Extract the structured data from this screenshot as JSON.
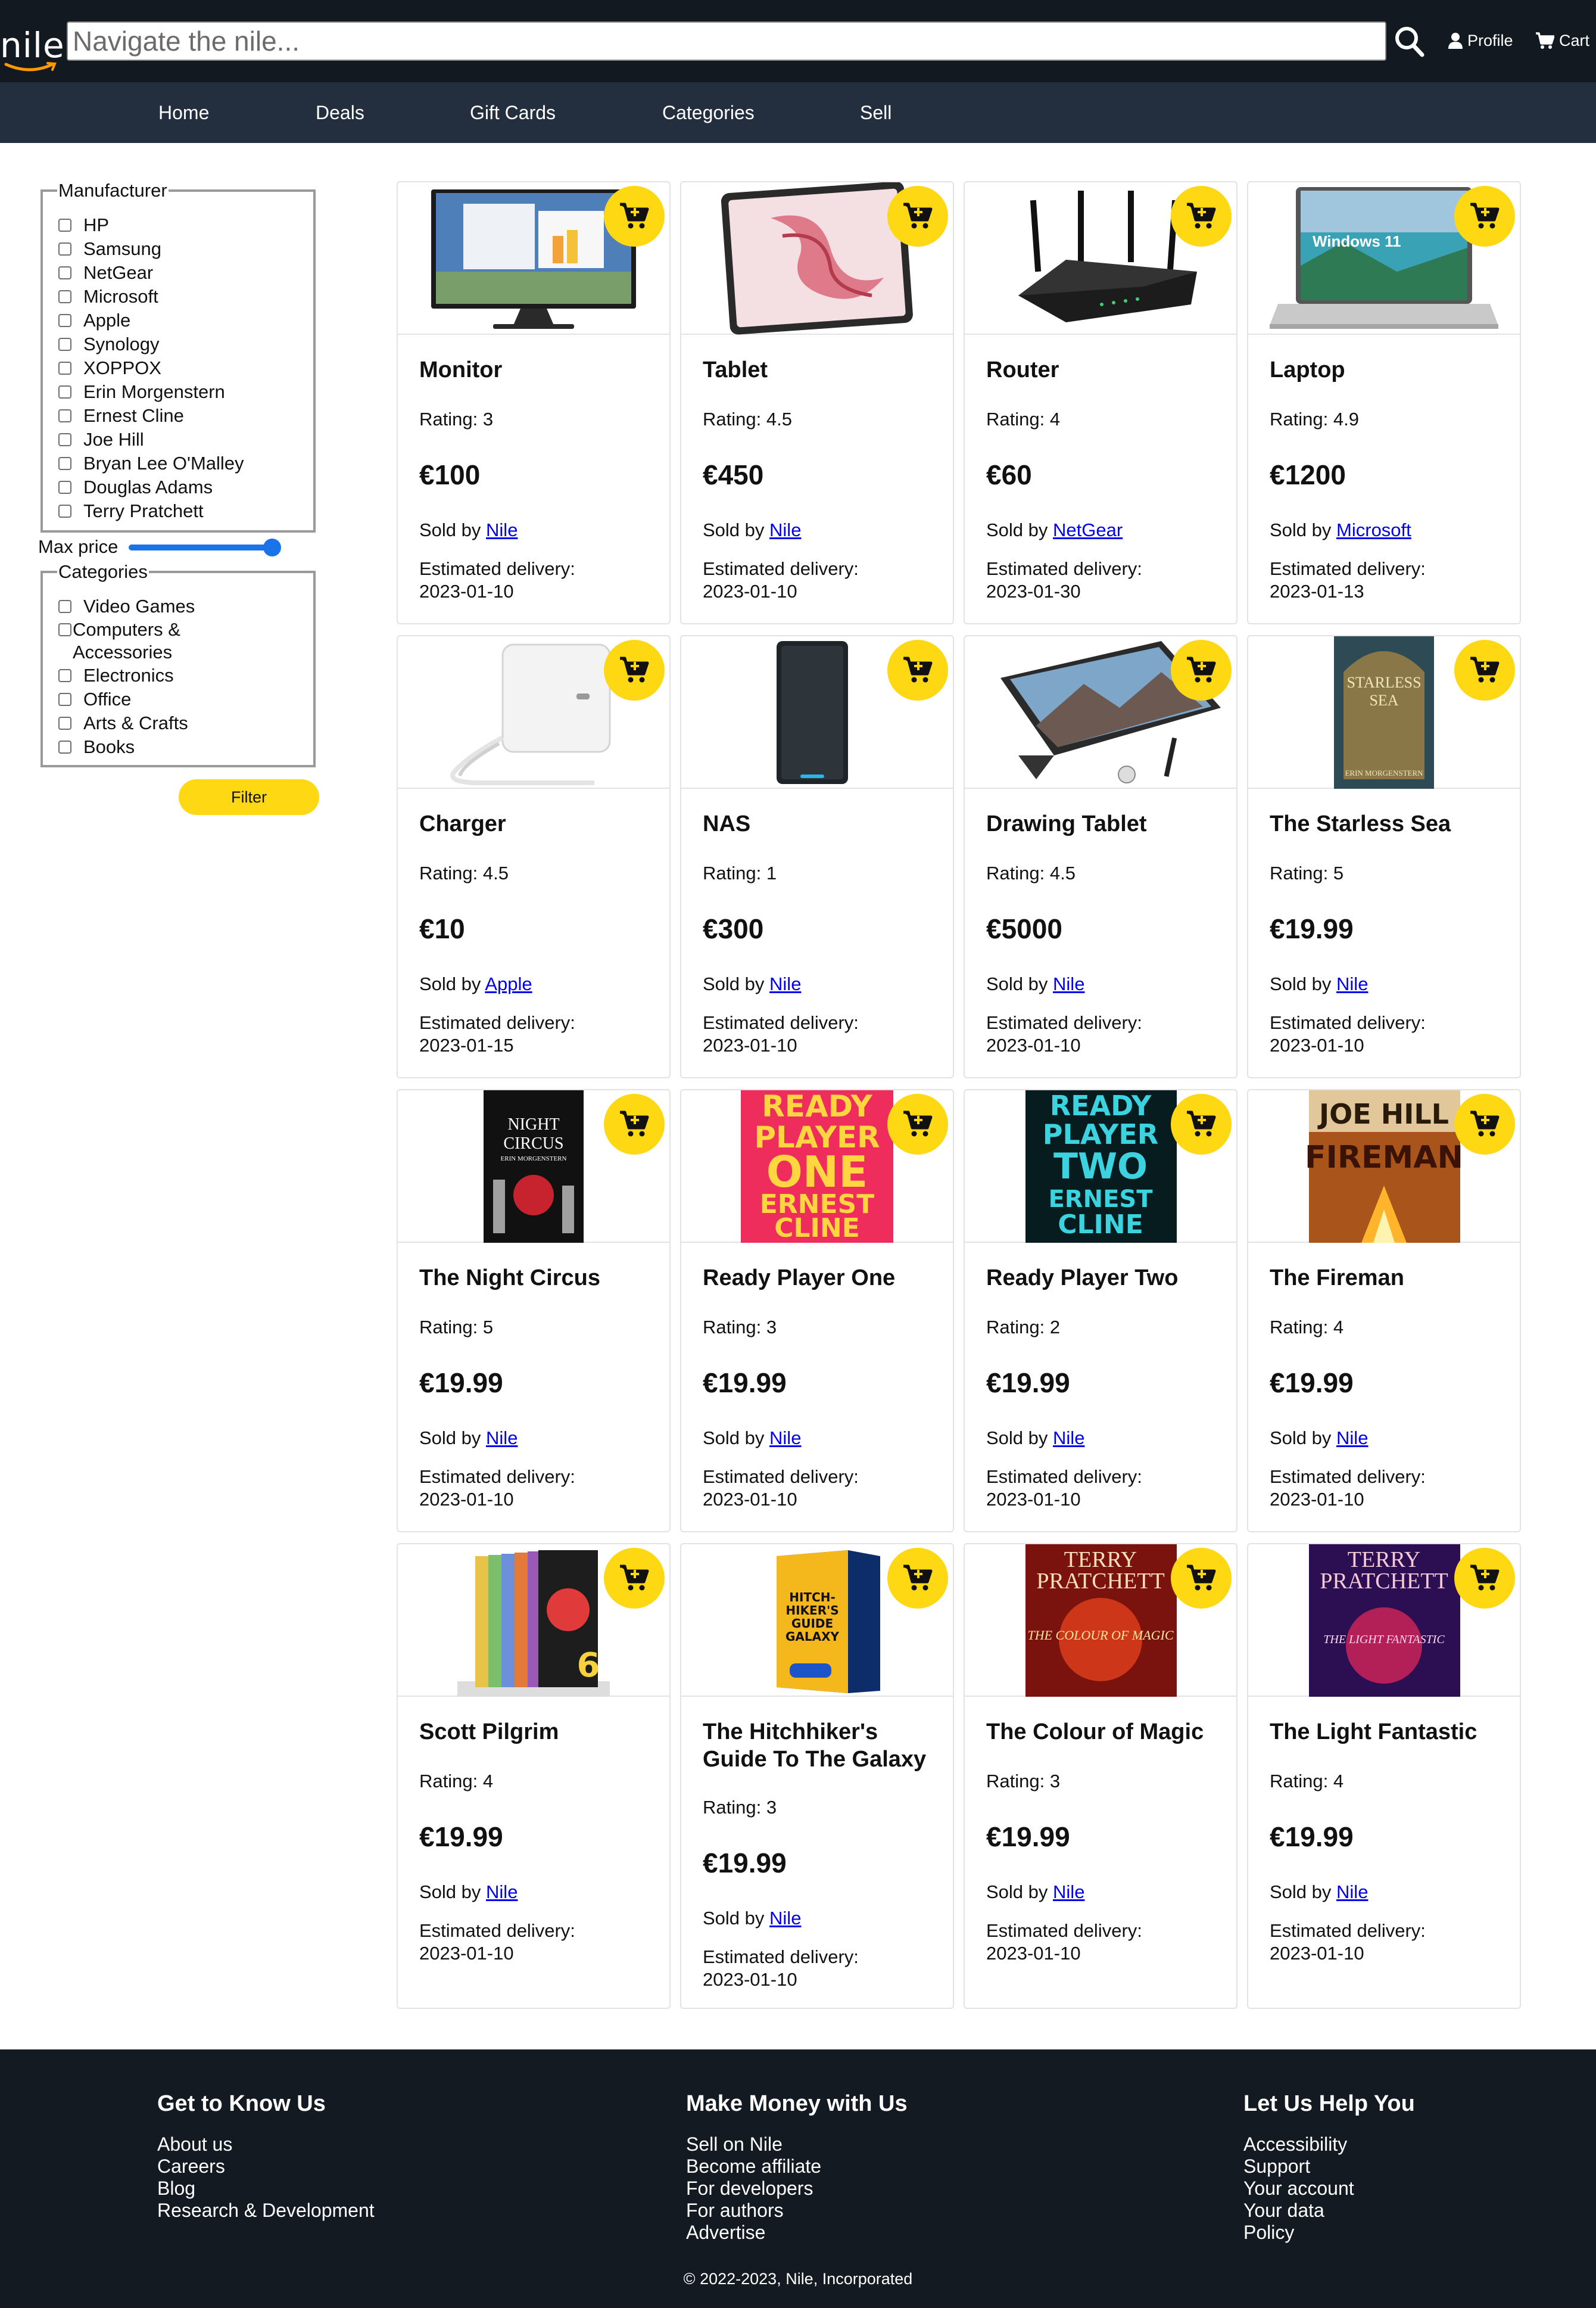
{
  "header": {
    "logo_text": "nile",
    "search_placeholder": "Navigate the nile...",
    "profile_label": "Profile",
    "cart_label": "Cart"
  },
  "nav": {
    "items": [
      "Home",
      "Deals",
      "Gift Cards",
      "Categories",
      "Sell"
    ]
  },
  "filters": {
    "manufacturer_legend": "Manufacturer",
    "manufacturers": [
      "HP",
      "Samsung",
      "NetGear",
      "Microsoft",
      "Apple",
      "Synology",
      "XOPPOX",
      "Erin Morgenstern",
      "Ernest Cline",
      "Joe Hill",
      "Bryan Lee O'Malley",
      "Douglas Adams",
      "Terry Pratchett"
    ],
    "max_price_label": "Max price",
    "max_price_level": 1.0,
    "categories_legend": "Categories",
    "categories": [
      "Video Games",
      "Computers & Accessories",
      "Electronics",
      "Office",
      "Arts & Crafts",
      "Books"
    ],
    "filter_button": "Filter"
  },
  "products": [
    {
      "name": "Monitor",
      "rating": "Rating: 3",
      "price": "€100",
      "sold_by_prefix": "Sold by",
      "seller": "Nile",
      "delivery_label": "Estimated delivery:",
      "delivery_date": "2023-01-10",
      "image": "monitor"
    },
    {
      "name": "Tablet",
      "rating": "Rating: 4.5",
      "price": "€450",
      "sold_by_prefix": "Sold by",
      "seller": "Nile",
      "delivery_label": "Estimated delivery:",
      "delivery_date": "2023-01-10",
      "image": "tablet"
    },
    {
      "name": "Router",
      "rating": "Rating: 4",
      "price": "€60",
      "sold_by_prefix": "Sold by",
      "seller": "NetGear",
      "delivery_label": "Estimated delivery:",
      "delivery_date": "2023-01-30",
      "image": "router"
    },
    {
      "name": "Laptop",
      "rating": "Rating: 4.9",
      "price": "€1200",
      "sold_by_prefix": "Sold by",
      "seller": "Microsoft",
      "delivery_label": "Estimated delivery:",
      "delivery_date": "2023-01-13",
      "image": "laptop",
      "image_text": "Windows 11"
    },
    {
      "name": "Charger",
      "rating": "Rating: 4.5",
      "price": "€10",
      "sold_by_prefix": "Sold by",
      "seller": "Apple",
      "delivery_label": "Estimated delivery:",
      "delivery_date": "2023-01-15",
      "image": "charger"
    },
    {
      "name": "NAS",
      "rating": "Rating: 1",
      "price": "€300",
      "sold_by_prefix": "Sold by",
      "seller": "Nile",
      "delivery_label": "Estimated delivery:",
      "delivery_date": "2023-01-10",
      "image": "nas"
    },
    {
      "name": "Drawing Tablet",
      "rating": "Rating: 4.5",
      "price": "€5000",
      "sold_by_prefix": "Sold by",
      "seller": "Nile",
      "delivery_label": "Estimated delivery:",
      "delivery_date": "2023-01-10",
      "image": "drawing-tablet"
    },
    {
      "name": "The Starless Sea",
      "rating": "Rating: 5",
      "price": "€19.99",
      "sold_by_prefix": "Sold by",
      "seller": "Nile",
      "delivery_label": "Estimated delivery:",
      "delivery_date": "2023-01-10",
      "image": "book-starless-sea",
      "image_text": "STARLESS SEA",
      "image_subtext": "ERIN MORGENSTERN"
    },
    {
      "name": "The Night Circus",
      "rating": "Rating: 5",
      "price": "€19.99",
      "sold_by_prefix": "Sold by",
      "seller": "Nile",
      "delivery_label": "Estimated delivery:",
      "delivery_date": "2023-01-10",
      "image": "book-night-circus",
      "image_text": "NIGHT CIRCUS",
      "image_subtext": "ERIN MORGENSTERN"
    },
    {
      "name": "Ready Player One",
      "rating": "Rating: 3",
      "price": "€19.99",
      "sold_by_prefix": "Sold by",
      "seller": "Nile",
      "delivery_label": "Estimated delivery:",
      "delivery_date": "2023-01-10",
      "image": "book-ready-player-one",
      "image_text": "READY PLAYER ONE",
      "image_subtext": "ERNEST CLINE"
    },
    {
      "name": "Ready Player Two",
      "rating": "Rating: 2",
      "price": "€19.99",
      "sold_by_prefix": "Sold by",
      "seller": "Nile",
      "delivery_label": "Estimated delivery:",
      "delivery_date": "2023-01-10",
      "image": "book-ready-player-two",
      "image_text": "READY PLAYER TWO",
      "image_subtext": "ERNEST CLINE"
    },
    {
      "name": "The Fireman",
      "rating": "Rating: 4",
      "price": "€19.99",
      "sold_by_prefix": "Sold by",
      "seller": "Nile",
      "delivery_label": "Estimated delivery:",
      "delivery_date": "2023-01-10",
      "image": "book-fireman",
      "image_text": "JOE HILL",
      "image_subtext": "FIREMAN"
    },
    {
      "name": "Scott Pilgrim",
      "rating": "Rating: 4",
      "price": "€19.99",
      "sold_by_prefix": "Sold by",
      "seller": "Nile",
      "delivery_label": "Estimated delivery:",
      "delivery_date": "2023-01-10",
      "image": "book-scott-pilgrim",
      "image_text": "6"
    },
    {
      "name": "The Hitchhiker's Guide To The Galaxy",
      "rating": "Rating: 3",
      "price": "€19.99",
      "sold_by_prefix": "Sold by",
      "seller": "Nile",
      "delivery_label": "Estimated delivery:",
      "delivery_date": "2023-01-10",
      "image": "book-hitchhikers",
      "image_text": "HITCH-HIKER'S GUIDE TO THE GALAXY"
    },
    {
      "name": "The Colour of Magic",
      "rating": "Rating: 3",
      "price": "€19.99",
      "sold_by_prefix": "Sold by",
      "seller": "Nile",
      "delivery_label": "Estimated delivery:",
      "delivery_date": "2023-01-10",
      "image": "book-colour-of-magic",
      "image_text": "TERRY PRATCHETT",
      "image_subtext": "THE COLOUR OF MAGIC"
    },
    {
      "name": "The Light Fantastic",
      "rating": "Rating: 4",
      "price": "€19.99",
      "sold_by_prefix": "Sold by",
      "seller": "Nile",
      "delivery_label": "Estimated delivery:",
      "delivery_date": "2023-01-10",
      "image": "book-light-fantastic",
      "image_text": "TERRY PRATCHETT",
      "image_subtext": "THE LIGHT FANTASTIC"
    }
  ],
  "footer": {
    "columns": [
      {
        "heading": "Get to Know Us",
        "links": [
          "About us",
          "Careers",
          "Blog",
          "Research & Development"
        ]
      },
      {
        "heading": "Make Money with Us",
        "links": [
          "Sell on Nile",
          "Become affiliate",
          "For developers",
          "For authors",
          "Advertise"
        ]
      },
      {
        "heading": "Let Us Help You",
        "links": [
          "Accessibility",
          "Support",
          "Your account",
          "Your data",
          "Policy"
        ]
      }
    ],
    "copyright": "© 2022-2023, Nile, Incorporated"
  },
  "colors": {
    "header_bg": "#131921",
    "nav_bg": "#232f3e",
    "accent_yellow": "#ffd814",
    "link_blue": "#0000ee",
    "footer_bg": "#131a22"
  },
  "icons": [
    "search-icon",
    "profile-icon",
    "cart-icon",
    "add-to-cart-icon"
  ]
}
